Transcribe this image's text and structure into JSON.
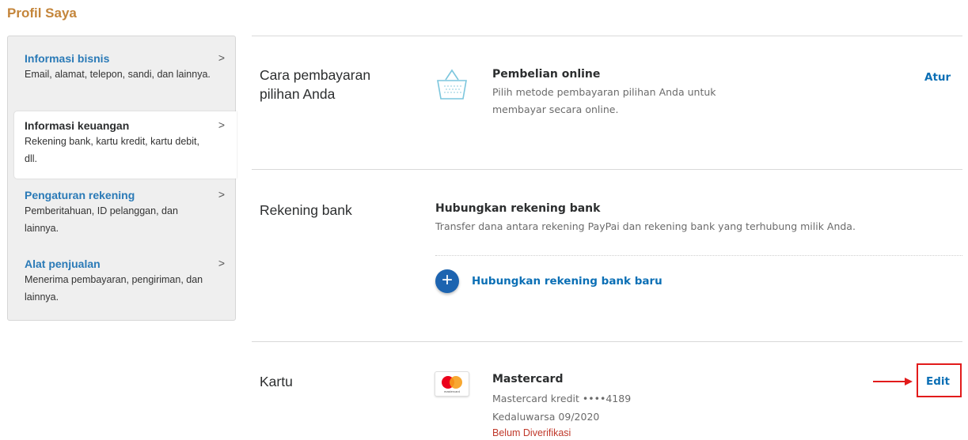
{
  "page_title": "Profil Saya",
  "sidebar": {
    "items": [
      {
        "label": "Informasi bisnis",
        "desc": "Email, alamat, telepon, sandi, dan lainnya.",
        "chevron": ">"
      },
      {
        "label": "Informasi keuangan",
        "desc": "Rekening bank, kartu kredit, kartu debit, dll.",
        "chevron": ">"
      },
      {
        "label": "Pengaturan rekening",
        "desc": "Pemberitahuan, ID pelanggan, dan lainnya.",
        "chevron": ">"
      },
      {
        "label": "Alat penjualan",
        "desc": "Menerima pembayaran, pengiriman, dan lainnya.",
        "chevron": ">"
      }
    ]
  },
  "payment_pref": {
    "label": "Cara pembayaran pilihan Anda",
    "title": "Pembelian online",
    "desc": "Pilih metode pembayaran pilihan Anda untuk membayar secara online.",
    "action": "Atur",
    "icon": "shopping-basket-icon"
  },
  "bank": {
    "label": "Rekening bank",
    "title": "Hubungkan rekening bank",
    "desc": "Transfer dana antara rekening PayPai dan rekening bank yang terhubung milik Anda.",
    "add_link": "Hubungkan rekening bank baru",
    "icon": "plus-circle-icon"
  },
  "cards": {
    "label": "Kartu",
    "title": "Mastercard",
    "line1": "Mastercard kredit ••••4189",
    "line2": "Kedaluwarsa 09/2020",
    "status": "Belum Diverifikasi",
    "action": "Edit",
    "brand_text": "mastercard",
    "icon": "mastercard-logo-icon"
  },
  "colors": {
    "accent": "#0b6fb5",
    "title": "#c4853a",
    "highlight": "#e21b1b",
    "status": "#c0392b"
  }
}
